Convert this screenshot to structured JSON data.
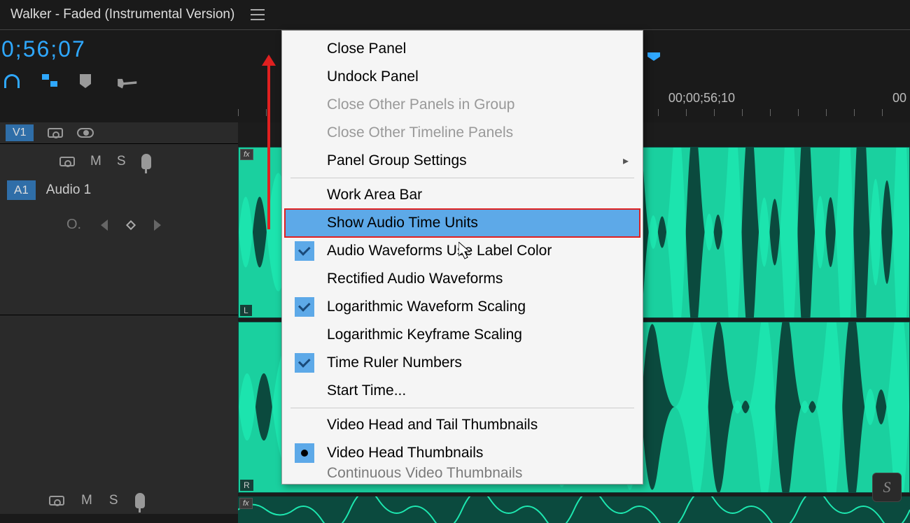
{
  "tab": {
    "title": "Walker - Faded (Instrumental Version)"
  },
  "timecode": "0;56;07",
  "ruler": {
    "tc1": "00;00;56;10",
    "tc2": "00"
  },
  "tracks": {
    "v1": "V1",
    "a1": {
      "tag": "A1",
      "label": "Audio 1"
    },
    "mute": "M",
    "solo": "S",
    "fx": "fx",
    "chL": "L",
    "chR": "R"
  },
  "keyframe_nav": {
    "diamond_label": "O."
  },
  "menu": {
    "close_panel": "Close Panel",
    "undock_panel": "Undock Panel",
    "close_other_group": "Close Other Panels in Group",
    "close_other_timeline": "Close Other Timeline Panels",
    "panel_group_settings": "Panel Group Settings",
    "work_area_bar": "Work Area Bar",
    "show_audio_time_units": "Show Audio Time Units",
    "audio_wave_label_color": "Audio Waveforms Use Label Color",
    "rectified": "Rectified Audio Waveforms",
    "log_waveform": "Logarithmic Waveform Scaling",
    "log_keyframe": "Logarithmic Keyframe Scaling",
    "time_ruler_numbers": "Time Ruler Numbers",
    "start_time": "Start Time...",
    "video_head_tail": "Video Head and Tail Thumbnails",
    "video_head": "Video Head Thumbnails",
    "continuous": "Continuous Video Thumbnails"
  },
  "watermark": "S"
}
